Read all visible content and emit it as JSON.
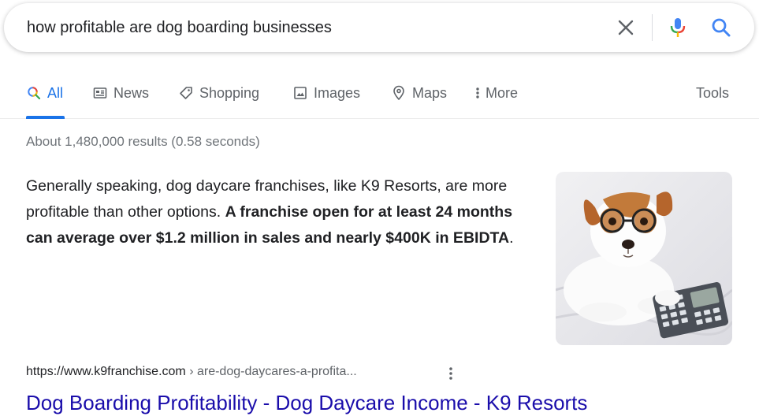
{
  "search": {
    "query": "how profitable are dog boarding businesses"
  },
  "tabs": [
    {
      "label": "All",
      "icon": "search-icon",
      "active": true
    },
    {
      "label": "News",
      "icon": "news-icon"
    },
    {
      "label": "Shopping",
      "icon": "tag-icon"
    },
    {
      "label": "Images",
      "icon": "image-icon"
    },
    {
      "label": "Maps",
      "icon": "map-pin-icon"
    },
    {
      "label": "More",
      "icon": "more-vertical-icon"
    }
  ],
  "tools_label": "Tools",
  "result_stats": "About 1,480,000 results (0.58 seconds)",
  "featured_snippet": {
    "text_plain": "Generally speaking, dog daycare franchises, like K9 Resorts, are more profitable than other options. ",
    "text_bold": "A franchise open for at least 24 months can average over $1.2 million in sales and nearly $400K in EBIDTA",
    "text_end": "."
  },
  "thumbnail": {
    "subject": "dog-with-glasses-and-calculator"
  },
  "result": {
    "cite_domain": "https://www.k9franchise.com",
    "cite_path": " › are-dog-daycares-a-profita...",
    "title": "Dog Boarding Profitability - Dog Daycare Income - K9 Resorts"
  },
  "colors": {
    "accent": "#1a73e8",
    "link": "#1a0dab",
    "muted": "#5f6368"
  }
}
